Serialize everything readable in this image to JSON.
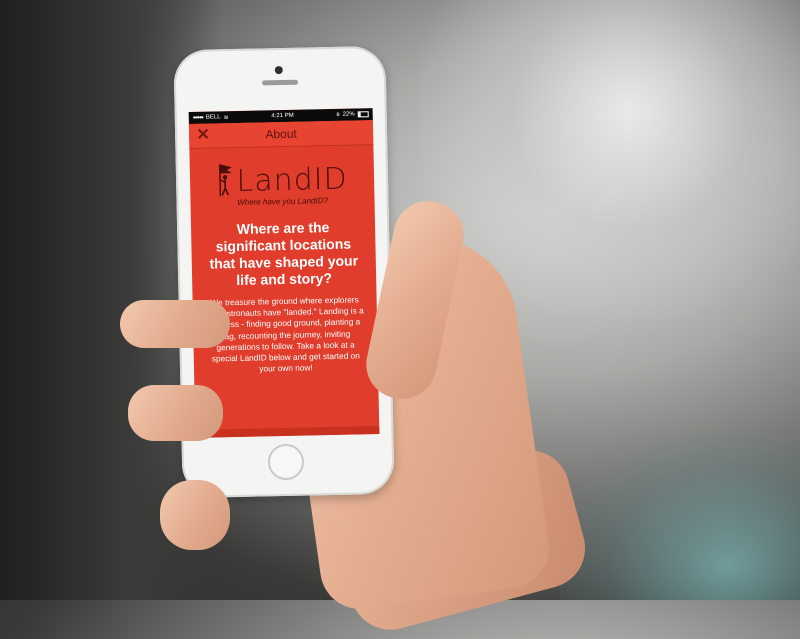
{
  "statusbar": {
    "carrier": "BELL",
    "time": "4:21 PM",
    "battery": "22%"
  },
  "navbar": {
    "title": "About",
    "close_icon": "close-icon"
  },
  "content": {
    "logo_text": "LandID",
    "tagline": "Where have you LandID?",
    "headline": "Where are the significant locations that have shaped your life and story?",
    "body": "We treasure the ground where explorers and astronauts have \"landed.\" Landing is a process - finding good ground, planting a flag, recounting the journey, inviting generations to follow. Take a look at a special LandID below and get started on your own now!"
  },
  "colors": {
    "accent": "#e03d2c",
    "logo": "#4a0e09"
  }
}
